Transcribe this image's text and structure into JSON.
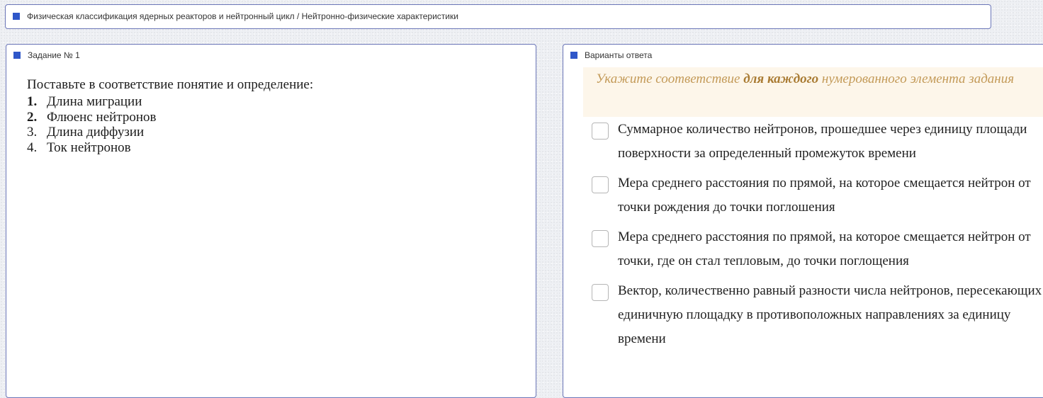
{
  "breadcrumb": {
    "text": "Физическая классификация ядерных реакторов и нейтронный цикл / Нейтронно-физические характеристики",
    "icon": "square-icon"
  },
  "task": {
    "header": "Задание № 1",
    "question": "Поставьте в соответствие понятие и определение:",
    "items": [
      {
        "num": "1.",
        "text": "Длина миграции"
      },
      {
        "num": "2.",
        "text": "Флюенс нейтронов"
      },
      {
        "num": "3.",
        "text": "Длина диффузии"
      },
      {
        "num": "4.",
        "text": "Ток нейтронов"
      }
    ]
  },
  "answers": {
    "header": "Варианты ответа",
    "instruction_pre": "Укажите соответствие ",
    "instruction_bold": "для каждого",
    "instruction_post": " нумерованного элемента задания",
    "options": [
      {
        "text": "Суммарное количество нейтронов, прошедшее через единицу площади поверхности за определенный промежуток времени",
        "checked": false
      },
      {
        "text": "Мера среднего расстояния по прямой, на которое смещается нейтрон от точки рождения до точки поглошения",
        "checked": false
      },
      {
        "text": "Мера среднего расстояния по прямой, на которое смещается нейтрон от точки, где он стал тепловым, до точки поглощения",
        "checked": false
      },
      {
        "text": "Вектор, количественно равный разности числа нейтронов, пересекающих единичную площадку в противоположных направлениях за единицу времени",
        "checked": false
      }
    ]
  },
  "colors": {
    "accent": "#2f57c9",
    "panel_border": "#6b76b8",
    "instruction_bg": "#fdf6ea",
    "instruction_text": "#c39a58"
  }
}
